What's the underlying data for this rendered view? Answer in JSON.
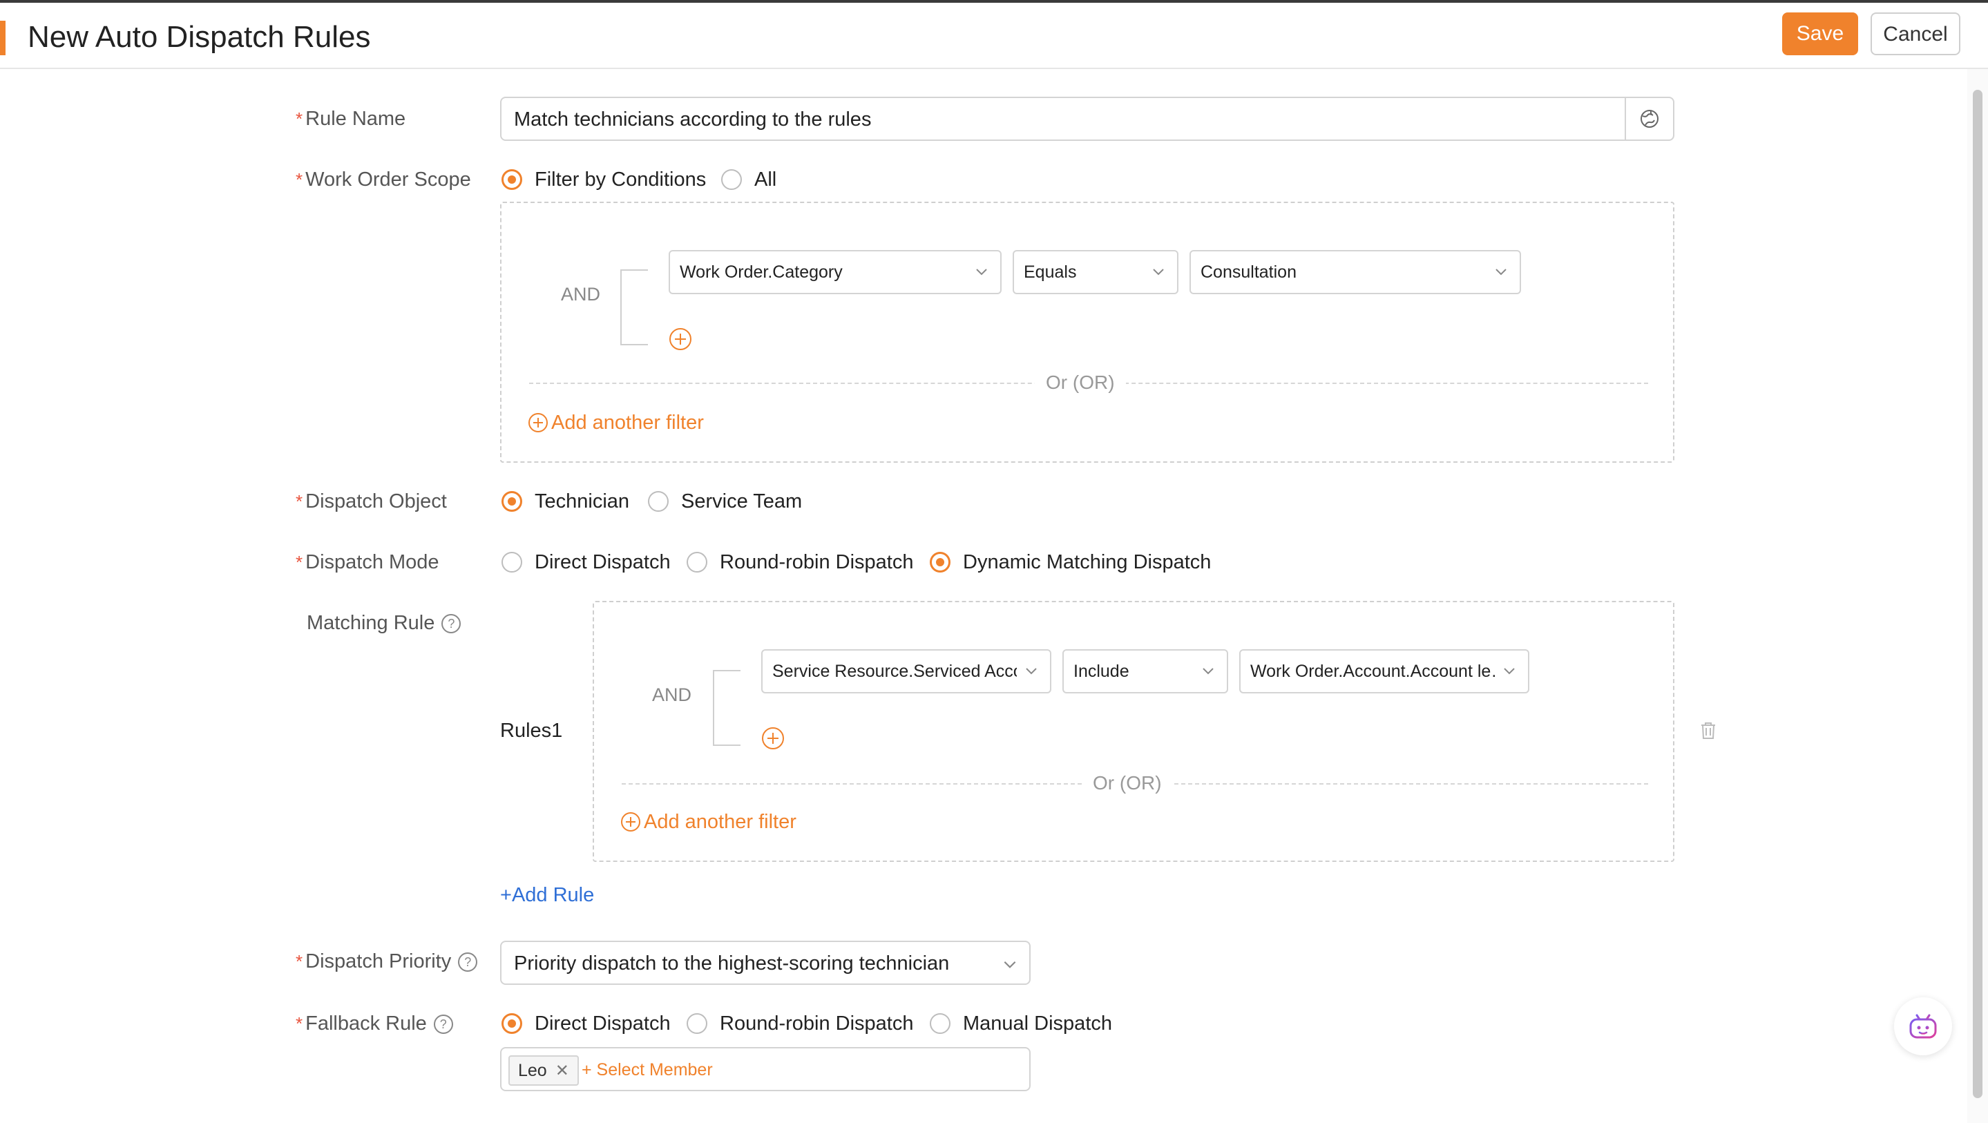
{
  "header": {
    "title": "New Auto Dispatch Rules",
    "save_label": "Save",
    "cancel_label": "Cancel"
  },
  "form": {
    "rule_name": {
      "label": "Rule Name",
      "value": "Match technicians according to the rules"
    },
    "work_order_scope": {
      "label": "Work Order Scope",
      "options": [
        "Filter by Conditions",
        "All"
      ],
      "selected": "Filter by Conditions",
      "filter": {
        "connector": "AND",
        "field": "Work Order.Category",
        "operator": "Equals",
        "value": "Consultation",
        "or_label": "Or (OR)",
        "add_filter_label": "Add another filter"
      }
    },
    "dispatch_object": {
      "label": "Dispatch Object",
      "options": [
        "Technician",
        "Service Team"
      ],
      "selected": "Technician"
    },
    "dispatch_mode": {
      "label": "Dispatch Mode",
      "options": [
        "Direct Dispatch",
        "Round-robin Dispatch",
        "Dynamic Matching Dispatch"
      ],
      "selected": "Dynamic Matching Dispatch"
    },
    "matching_rule": {
      "label": "Matching Rule",
      "rule_name": "Rules1",
      "connector": "AND",
      "field": "Service Resource.Serviced Acco",
      "operator": "Include",
      "value": "Work Order.Account.Account le…",
      "or_label": "Or (OR)",
      "add_filter_label": "Add another filter",
      "add_rule_label": "Add Rule"
    },
    "dispatch_priority": {
      "label": "Dispatch Priority",
      "value": "Priority dispatch to the highest-scoring technician"
    },
    "fallback_rule": {
      "label": "Fallback Rule",
      "options": [
        "Direct Dispatch",
        "Round-robin Dispatch",
        "Manual Dispatch"
      ],
      "selected": "Direct Dispatch",
      "member": "Leo",
      "select_member_label": "+ Select Member"
    }
  },
  "colors": {
    "accent": "#f0822c",
    "link": "#2f6fd6",
    "required": "#e8553f"
  }
}
